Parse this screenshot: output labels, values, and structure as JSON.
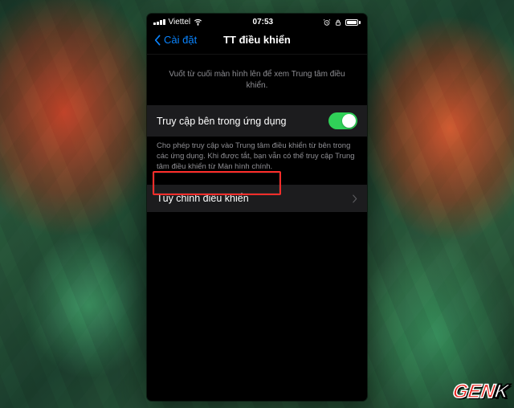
{
  "status": {
    "carrier": "Viettel",
    "time": "07:53"
  },
  "nav": {
    "back_label": "Cài đặt",
    "title": "TT điều khiển"
  },
  "hint": "Vuốt từ cuối màn hình lên để xem Trung tâm điều khiển.",
  "toggle_row": {
    "label": "Truy cập bên trong ứng dụng",
    "enabled": true
  },
  "toggle_note": "Cho phép truy cập vào Trung tâm điều khiển từ bên trong các ứng dụng. Khi được tắt, bạn vẫn có thể truy cập Trung tâm điều khiển từ Màn hình chính.",
  "customize_row": {
    "label": "Tùy chỉnh điều khiển"
  },
  "watermark": "GENK"
}
